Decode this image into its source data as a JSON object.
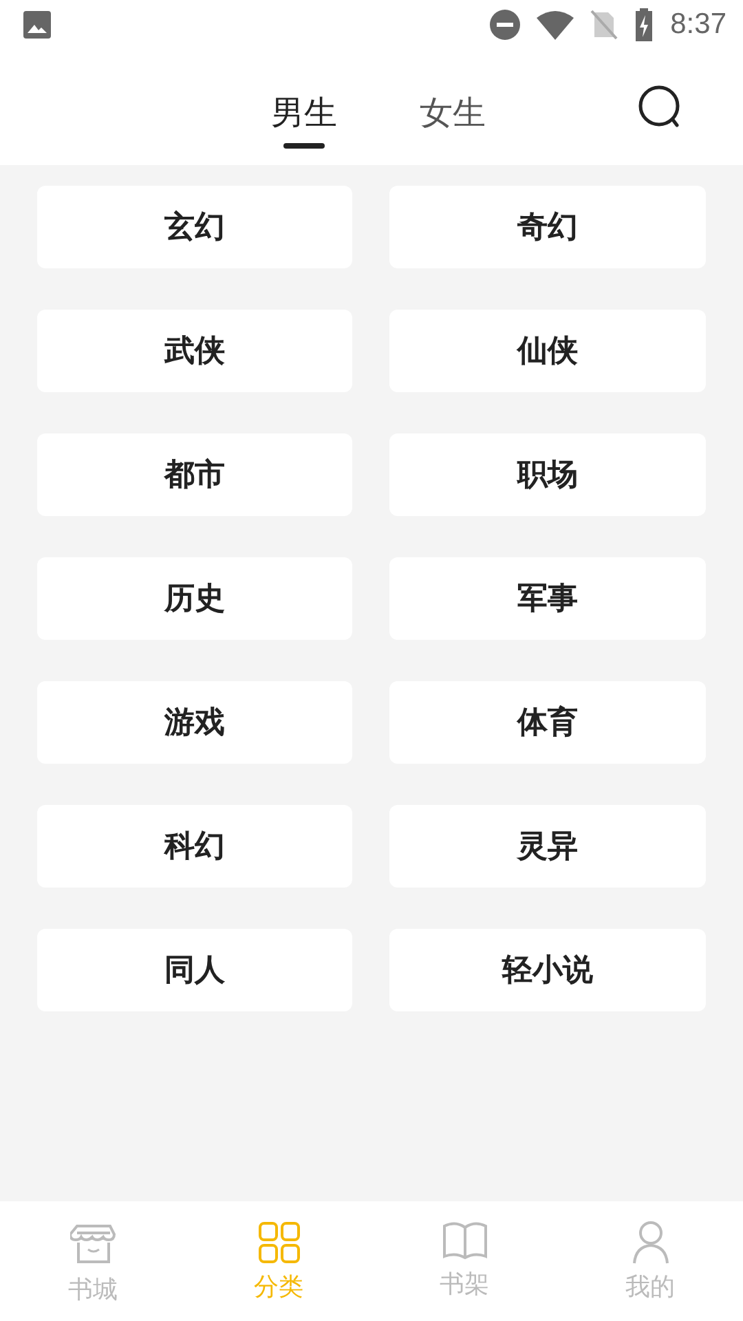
{
  "status_bar": {
    "time": "8:37"
  },
  "tabs": [
    {
      "label": "男生",
      "selected": true
    },
    {
      "label": "女生",
      "selected": false
    }
  ],
  "categories": [
    {
      "label": "玄幻"
    },
    {
      "label": "奇幻"
    },
    {
      "label": "武侠"
    },
    {
      "label": "仙侠"
    },
    {
      "label": "都市"
    },
    {
      "label": "职场"
    },
    {
      "label": "历史"
    },
    {
      "label": "军事"
    },
    {
      "label": "游戏"
    },
    {
      "label": "体育"
    },
    {
      "label": "科幻"
    },
    {
      "label": "灵异"
    },
    {
      "label": "同人"
    },
    {
      "label": "轻小说"
    }
  ],
  "bottom_nav": [
    {
      "label": "书城",
      "kind": "store",
      "selected": false
    },
    {
      "label": "分类",
      "kind": "grid",
      "selected": true
    },
    {
      "label": "书架",
      "kind": "book",
      "selected": false
    },
    {
      "label": "我的",
      "kind": "person",
      "selected": false
    }
  ]
}
